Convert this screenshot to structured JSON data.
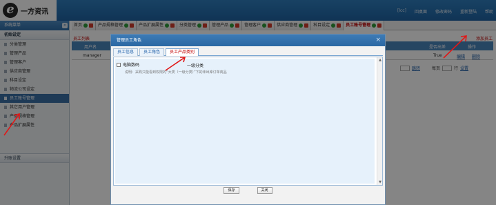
{
  "header": {
    "logo_mark": "e",
    "logo_text": "一方资讯",
    "links": [
      "[lcc]",
      "回桌面",
      "修改密码",
      "重新登陆",
      "帮助"
    ]
  },
  "sidebar": {
    "title": "系统菜单",
    "collapse": "«",
    "group1": "初始设定",
    "items": [
      "分类管理",
      "管理产品",
      "管理客户",
      "供应商管理",
      "科目设定",
      "物流公司设定",
      "员工账号管理",
      "其它用户管理",
      "产品规格管理",
      "产品扩展属性"
    ],
    "active_index": 6,
    "group2": "升账设置"
  },
  "tabs": [
    {
      "label": "首页"
    },
    {
      "label": "产品规格管理"
    },
    {
      "label": "产品扩展属性"
    },
    {
      "label": "分类管理"
    },
    {
      "label": "管理产品"
    },
    {
      "label": "管理客户"
    },
    {
      "label": "供应商管理"
    },
    {
      "label": "科目设定"
    },
    {
      "label": "员工账号管理",
      "active": true
    }
  ],
  "page": {
    "breadcrumb": "员工列表",
    "add_link": "添加员工",
    "columns": {
      "username": "用户名",
      "is_out": "是否出差",
      "action": "操作"
    },
    "row": {
      "username": "manager",
      "is_out": "True",
      "edit": "编辑",
      "delete": "删除"
    },
    "pager": {
      "jump": "跳转",
      "per_page": "每页",
      "rows": "行",
      "set": "设置"
    }
  },
  "dialog": {
    "title": "管理员工角色",
    "close": "×",
    "tabs": [
      "员工信息",
      "员工角色",
      "员工产品类别"
    ],
    "active_tab": 2,
    "checkbox_label": "电脑数码",
    "sub_category": "一级分类",
    "note": "说明：采购只能看到权限的“大类（一级分类）”下的未出库订单商品",
    "save": "保存",
    "close_btn": "关闭"
  },
  "colors": {
    "brand": "#2b68a3",
    "alert": "#c00000",
    "overlay": "rgba(0,0,0,0.48)"
  }
}
